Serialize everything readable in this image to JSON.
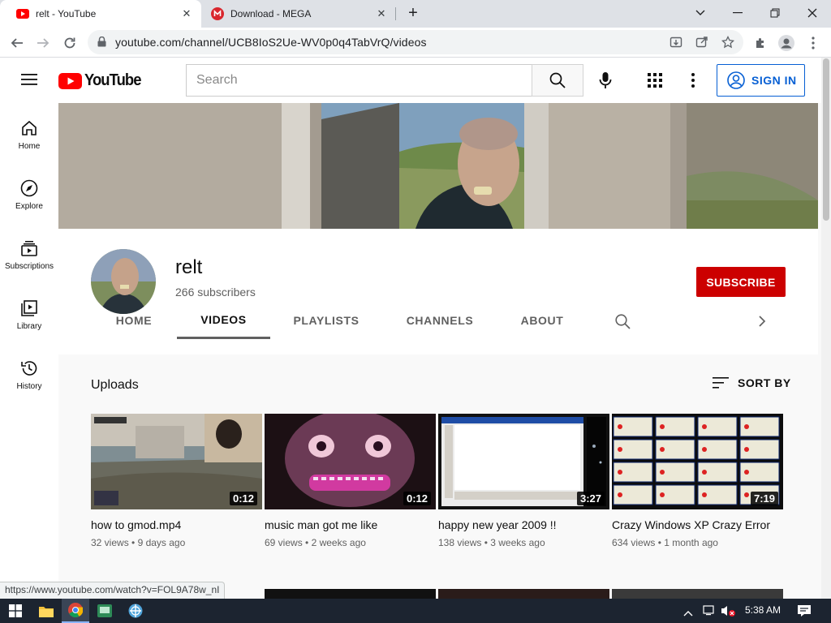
{
  "browser": {
    "tabs": [
      {
        "title": "relt - YouTube",
        "icon": "youtube-favicon"
      },
      {
        "title": "Download - MEGA",
        "icon": "mega-favicon"
      }
    ],
    "url": "youtube.com/channel/UCB8IoS2Ue-WV0p0q4TabVrQ/videos",
    "status_url": "https://www.youtube.com/watch?v=FOL9A78w_nI"
  },
  "youtube": {
    "logo_text": "YouTube",
    "search_placeholder": "Search",
    "sign_in": "SIGN IN",
    "sidebar": [
      {
        "label": "Home",
        "icon": "home-icon"
      },
      {
        "label": "Explore",
        "icon": "compass-icon"
      },
      {
        "label": "Subscriptions",
        "icon": "subscriptions-icon"
      },
      {
        "label": "Library",
        "icon": "library-icon"
      },
      {
        "label": "History",
        "icon": "history-icon"
      }
    ],
    "channel": {
      "name": "relt",
      "subscribers": "266 subscribers",
      "subscribe": "SUBSCRIBE"
    },
    "channel_tabs": [
      "HOME",
      "VIDEOS",
      "PLAYLISTS",
      "CHANNELS",
      "ABOUT"
    ],
    "active_tab": "VIDEOS",
    "section_title": "Uploads",
    "sort_by": "SORT BY",
    "videos": [
      {
        "title": "how to gmod.mp4",
        "views": "32 views",
        "age": "9 days ago",
        "duration": "0:12"
      },
      {
        "title": "music man got me like",
        "views": "69 views",
        "age": "2 weeks ago",
        "duration": "0:12"
      },
      {
        "title": "happy new year 2009 !!",
        "views": "138 views",
        "age": "3 weeks ago",
        "duration": "3:27"
      },
      {
        "title": "Crazy Windows XP Crazy Error",
        "views": "634 views",
        "age": "1 month ago",
        "duration": "7:19"
      }
    ]
  },
  "taskbar": {
    "time": "5:38 AM"
  },
  "colors": {
    "youtube_red": "#ff0000",
    "subscribe_red": "#cc0000",
    "signin_blue": "#065fd4",
    "taskbar": "#1c2430"
  }
}
